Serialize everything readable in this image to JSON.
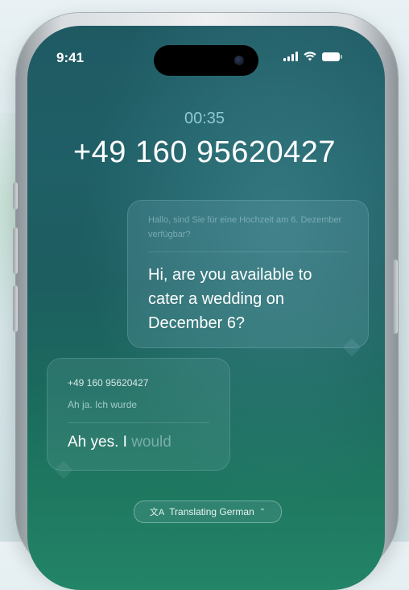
{
  "status_bar": {
    "time": "9:41",
    "signal_icon": "cellular-signal-icon",
    "wifi_icon": "wifi-icon",
    "battery_icon": "battery-icon"
  },
  "call": {
    "duration": "00:35",
    "number": "+49 160 95620427"
  },
  "outgoing_message": {
    "original": "Hallo, sind Sie für eine Hochzeit am 6. Dezember verfügbar?",
    "translation": "Hi, are you available to cater a wedding on December 6?"
  },
  "incoming_message": {
    "sender": "+49 160 95620427",
    "original": "Ah ja. Ich wurde",
    "translation_spoken": "Ah yes. I",
    "translation_pending": " would"
  },
  "translation_control": {
    "label": "Translating German",
    "icon": "translate-icon",
    "chevron": "up-down-chevron-icon"
  },
  "colors": {
    "screen_top": "#1f5a63",
    "screen_bottom": "#238467",
    "timer": "#8fc7d3"
  }
}
